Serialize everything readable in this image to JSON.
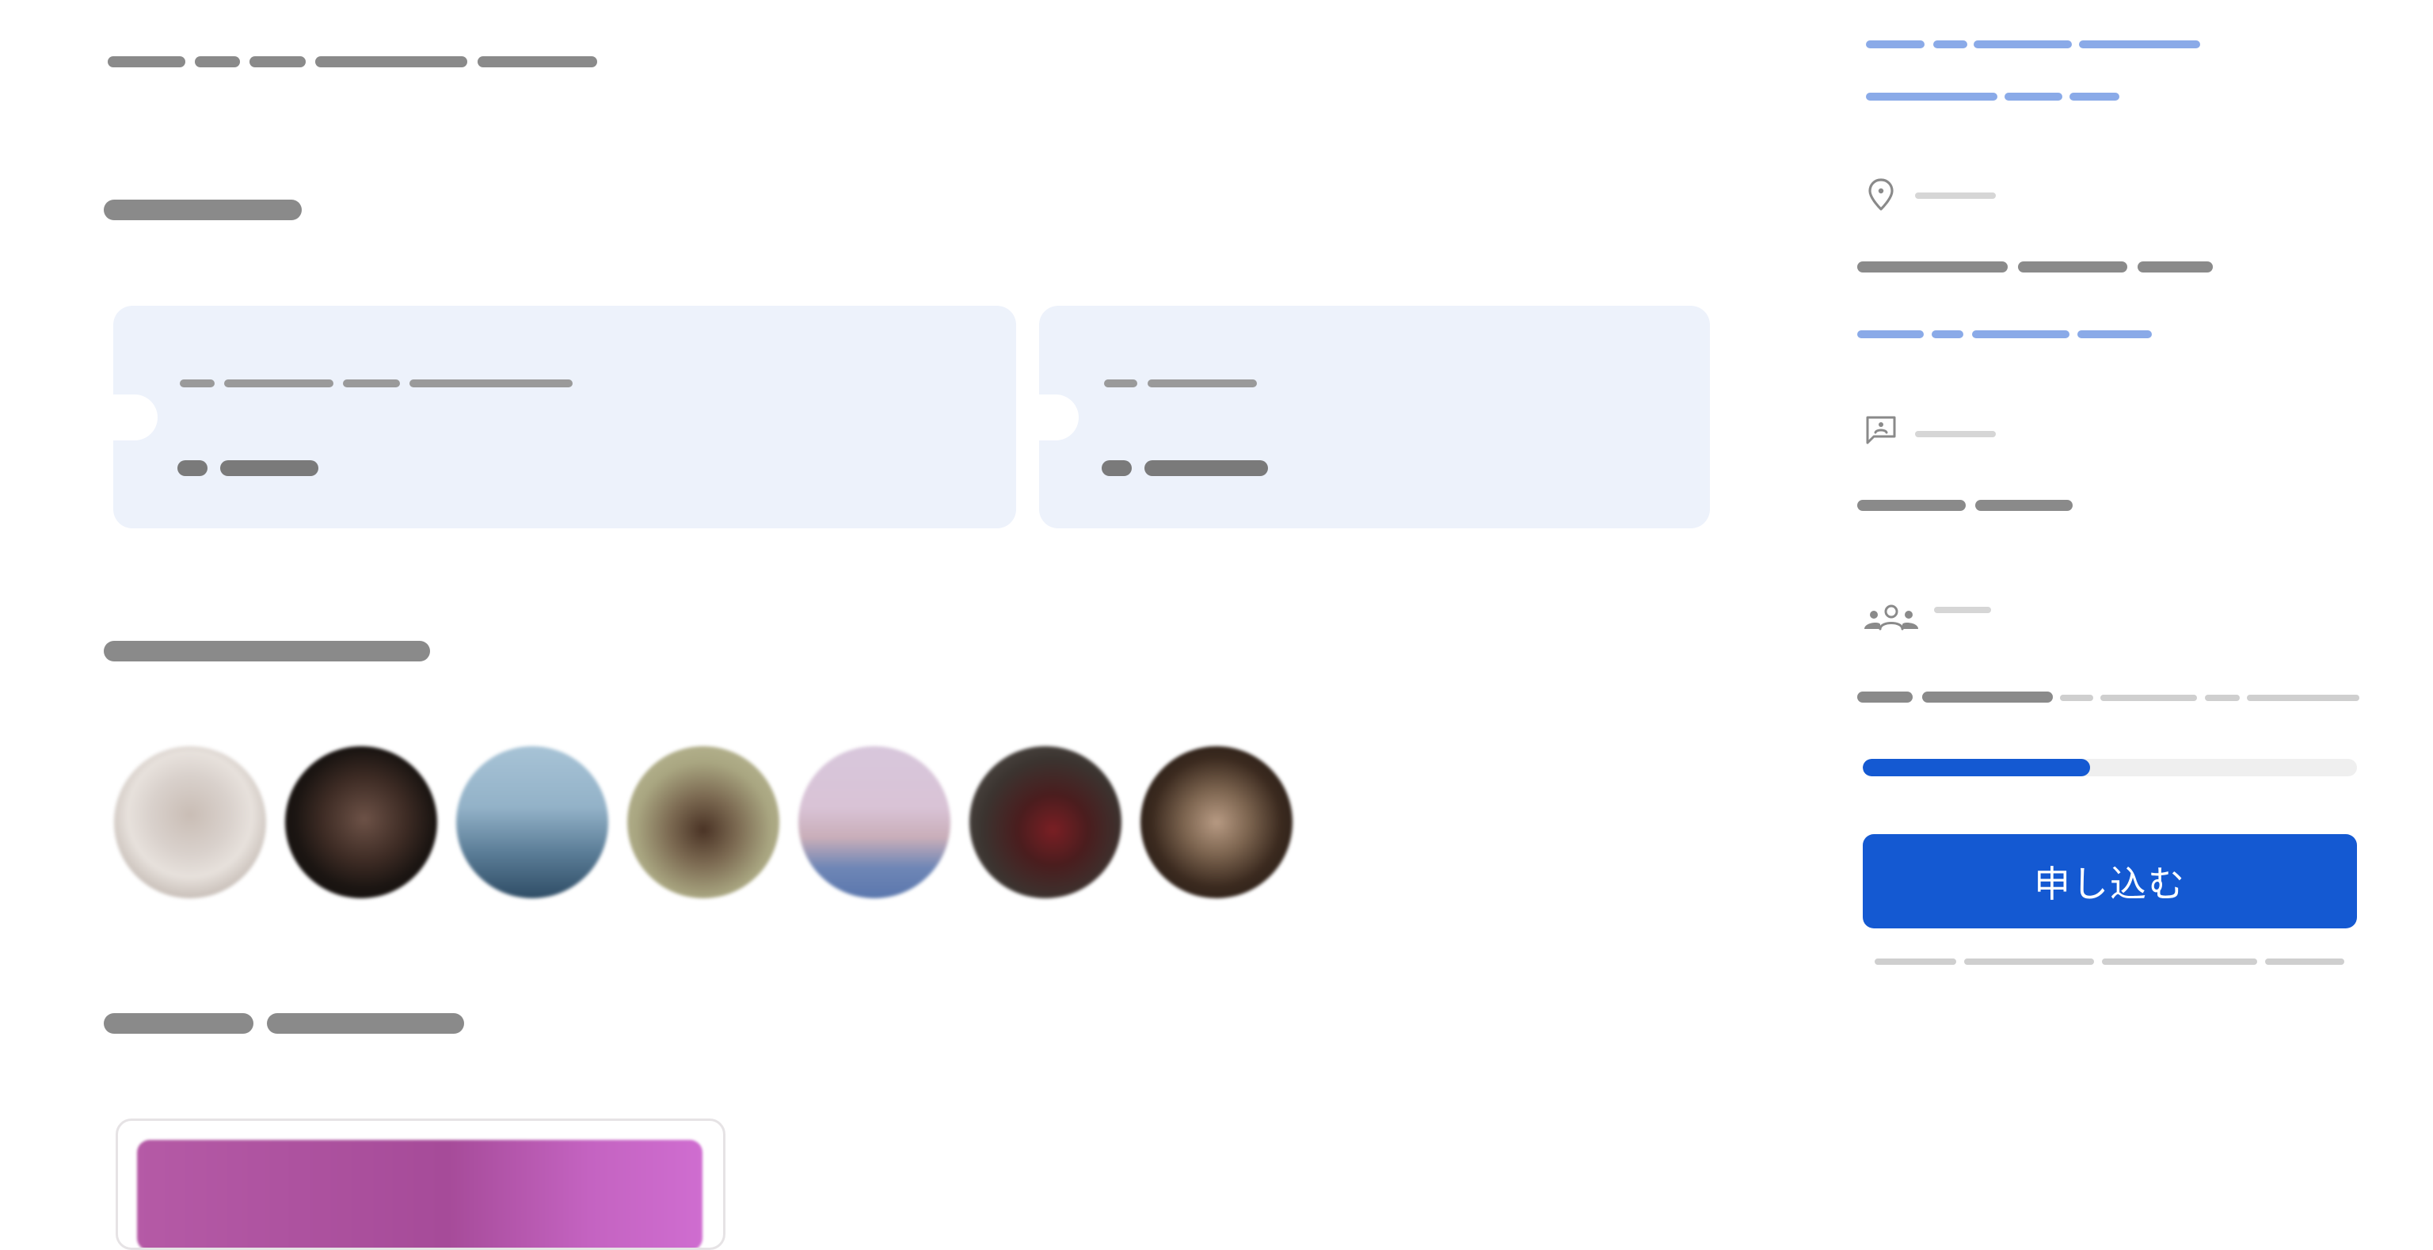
{
  "apply_button": {
    "label": "申し込む"
  },
  "progress": {
    "fraction": 0.46,
    "fill_color": "#1459d2",
    "track_color": "#efefef"
  },
  "icons": {
    "location": "map-pin-icon",
    "message": "message-square-icon",
    "people": "people-group-icon"
  },
  "colors": {
    "accent_blue": "#1459d2",
    "link_placeholder": "#8aaae8",
    "card_background": "#edf2fb",
    "text_placeholder": "#8a8a8a"
  },
  "avatars": [
    "avatar-1",
    "avatar-2",
    "avatar-3",
    "avatar-4",
    "avatar-5",
    "avatar-6",
    "avatar-7"
  ]
}
